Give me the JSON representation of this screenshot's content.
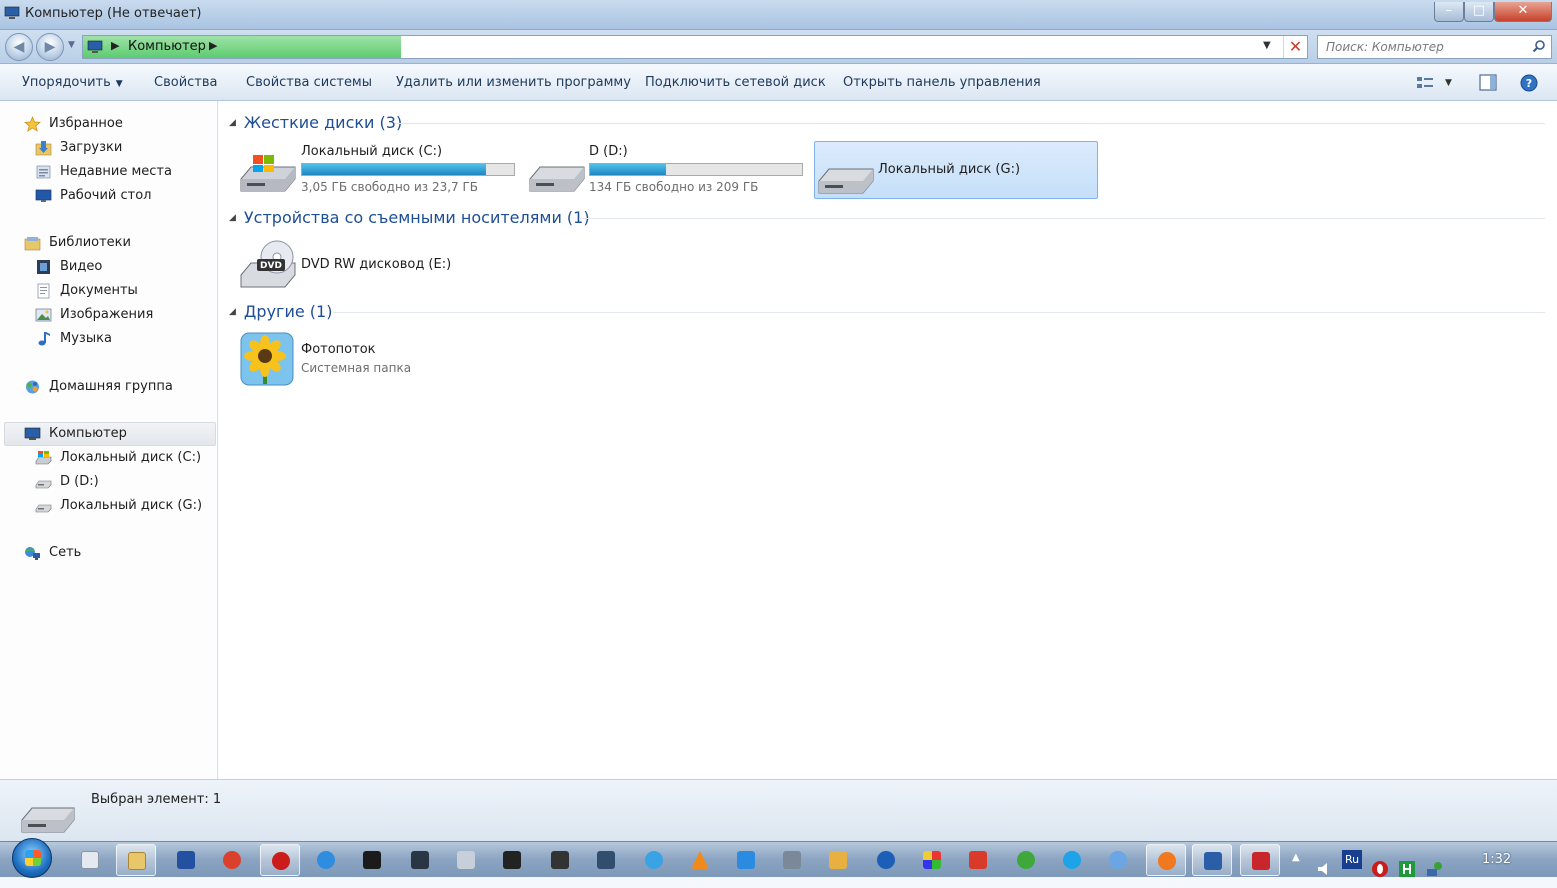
{
  "window": {
    "title": "Компьютер (Не отвечает)",
    "controls": {
      "minimize": "–",
      "maximize": "□",
      "close": "✕"
    }
  },
  "address": {
    "crumbs": [
      "Компьютер"
    ],
    "separator": "▶",
    "dropdown": "▼",
    "stop": "✕"
  },
  "search": {
    "placeholder": "Поиск: Компьютер"
  },
  "toolbar": {
    "organize": "Упорядочить",
    "properties": "Свойства",
    "system_properties": "Свойства системы",
    "uninstall": "Удалить или изменить программу",
    "map_drive": "Подключить сетевой диск",
    "control_panel": "Открыть панель управления",
    "caret": "▼"
  },
  "sidebar": {
    "favorites": {
      "label": "Избранное",
      "items": [
        "Загрузки",
        "Недавние места",
        "Рабочий стол"
      ]
    },
    "libraries": {
      "label": "Библиотеки",
      "items": [
        "Видео",
        "Документы",
        "Изображения",
        "Музыка"
      ]
    },
    "homegroup": {
      "label": "Домашняя группа"
    },
    "computer": {
      "label": "Компьютер",
      "items": [
        "Локальный диск (C:)",
        "D (D:)",
        "Локальный диск (G:)"
      ]
    },
    "network": {
      "label": "Сеть"
    }
  },
  "groups": {
    "hard_drives": {
      "title": "Жесткие диски (3)",
      "drives": [
        {
          "name": "Локальный диск (C:)",
          "free": "3,05 ГБ свободно из 23,7 ГБ",
          "used_fraction": 0.87
        },
        {
          "name": "D (D:)",
          "free": "134 ГБ свободно из 209 ГБ",
          "used_fraction": 0.36
        },
        {
          "name": "Локальный диск (G:)"
        }
      ]
    },
    "removable": {
      "title": "Устройства со съемными носителями (1)",
      "items": [
        {
          "name": "DVD RW дисковод (E:)",
          "badge": "DVD"
        }
      ]
    },
    "other": {
      "title": "Другие (1)",
      "items": [
        {
          "name": "Фотопоток",
          "sub": "Системная папка"
        }
      ]
    }
  },
  "status": {
    "text": "Выбран элемент: 1"
  },
  "taskbar": {
    "clock": "1:32",
    "tray_language": "Ru"
  },
  "colors": {
    "link_blue": "#1e4e96",
    "progress_green": "#5ccc6e",
    "drive_bar_blue": "#1f86c2",
    "selection_blue": "#c5dff8"
  }
}
